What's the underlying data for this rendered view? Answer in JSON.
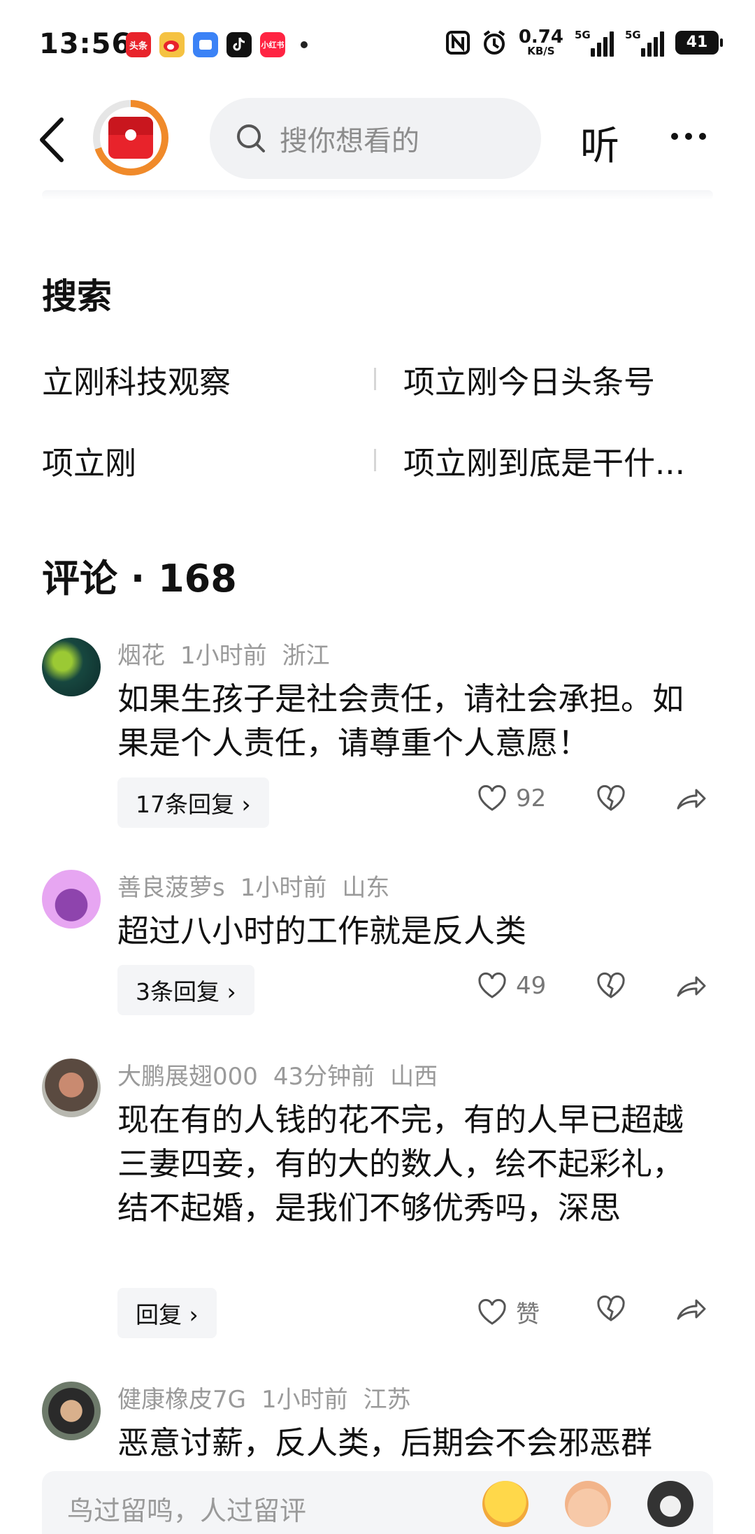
{
  "status_bar": {
    "time": "13:56",
    "apps": [
      {
        "label": "头条",
        "color": "#e8232b",
        "icon": "toutiao-icon"
      },
      {
        "label": "微博",
        "color": "#f5c242",
        "icon": "weibo-icon"
      },
      {
        "label": "",
        "color": "#3b82f6",
        "icon": "app-icon"
      },
      {
        "label": "抖",
        "color": "#111111",
        "icon": "douyin-icon"
      },
      {
        "label": "小红书",
        "color": "#ff2442",
        "icon": "xiaohongshu-icon"
      }
    ],
    "net_speed_value": "0.74",
    "net_speed_unit": "KB/S",
    "sim1": "5G",
    "sim2": "5G",
    "battery": "41"
  },
  "header": {
    "search_placeholder": "搜你想看的",
    "listen_label": "听"
  },
  "search_section": {
    "title": "搜索",
    "items": [
      "立刚科技观察",
      "项立刚今日头条号",
      "项立刚",
      "项立刚到底是干什..."
    ]
  },
  "comments_section": {
    "title": "评论 · 168"
  },
  "comments": [
    {
      "name": "烟花",
      "time": "1小时前",
      "location": "浙江",
      "text": "如果生孩子是社会责任，请社会承担。如果是个人责任，请尊重个人意愿！",
      "reply_label": "17条回复 ›",
      "likes": "92"
    },
    {
      "name": "善良菠萝s",
      "time": "1小时前",
      "location": "山东",
      "text": "超过八小时的工作就是反人类",
      "reply_label": "3条回复 ›",
      "likes": "49"
    },
    {
      "name": "大鹏展翅000",
      "time": "43分钟前",
      "location": "山西",
      "text": "现在有的人钱的花不完，有的人早已超越三妻四妾，有的大的数人，绘不起彩礼，结不起婚，是我们不够优秀吗，深思",
      "reply_label": "回复 ›",
      "likes": "赞"
    },
    {
      "name": "健康橡皮7G",
      "time": "1小时前",
      "location": "江苏",
      "text": "恶意讨薪，反人类，后期会不会邪恶群",
      "reply_label": "",
      "likes": ""
    }
  ],
  "bottom_bar": {
    "placeholder": "鸟过留鸣，人过留评"
  }
}
